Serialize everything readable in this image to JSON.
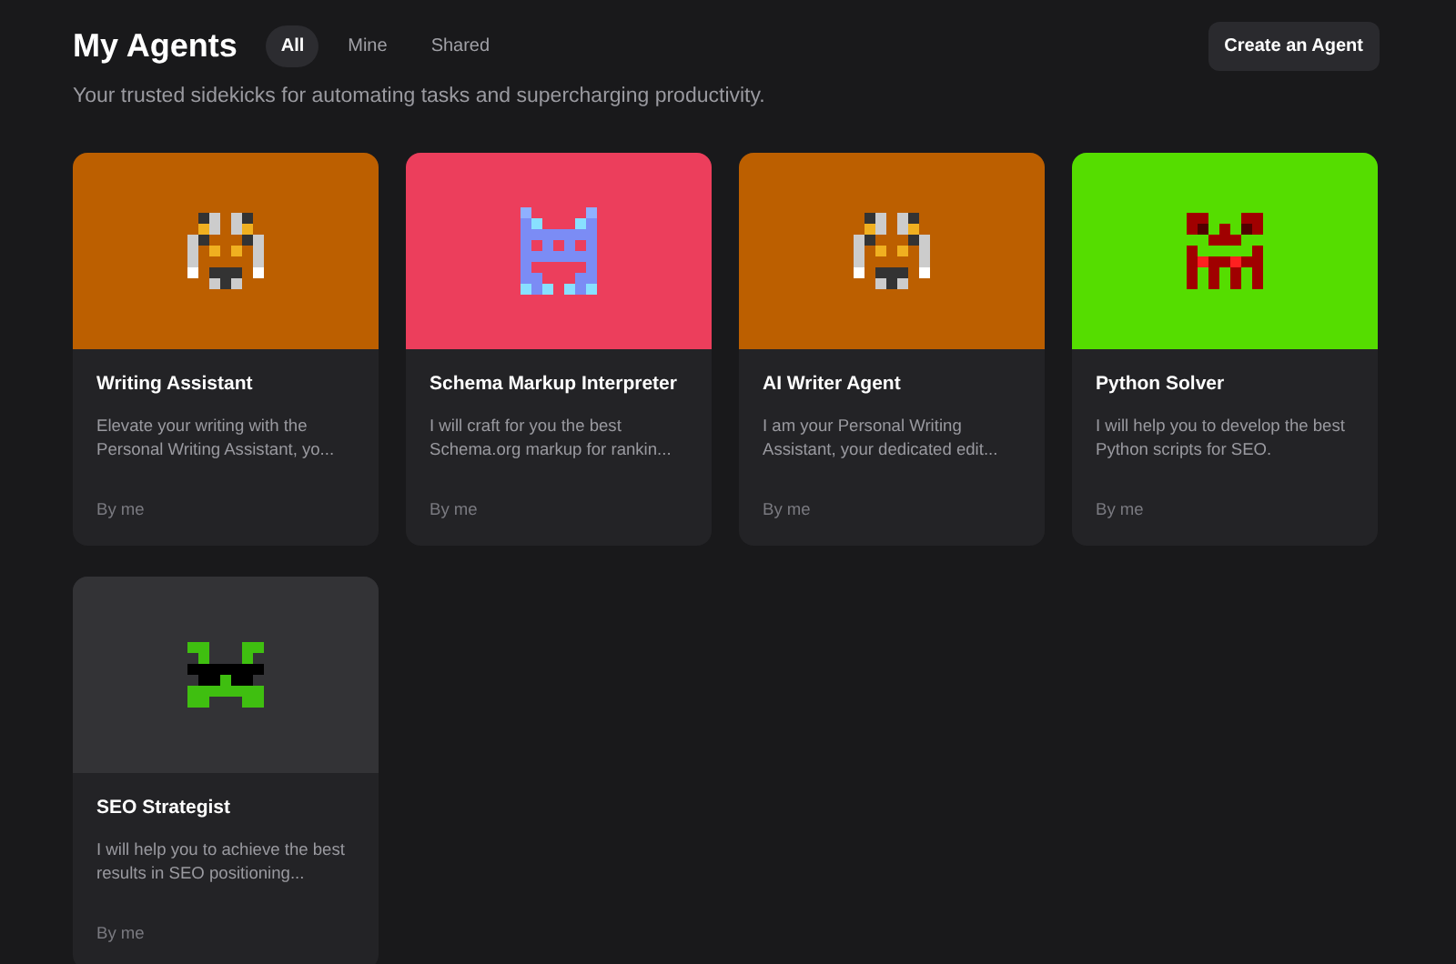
{
  "header": {
    "title": "My Agents",
    "subtitle": "Your trusted sidekicks for automating tasks and supercharging productivity.",
    "create_button": "Create an Agent"
  },
  "tabs": [
    {
      "label": "All",
      "selected": true
    },
    {
      "label": "Mine",
      "selected": false
    },
    {
      "label": "Shared",
      "selected": false
    }
  ],
  "agents": [
    {
      "name": "Writing Assistant",
      "description": "Elevate your writing with the Personal Writing Assistant, yo...",
      "author": "By me",
      "color": "#bc5f00",
      "kind": "fox"
    },
    {
      "name": "Schema Markup Interpreter",
      "description": "I will craft for you the best Schema.org markup for rankin...",
      "author": "By me",
      "color": "#ec3e5c",
      "kind": "robot"
    },
    {
      "name": "AI Writer Agent",
      "description": "I am your Personal Writing Assistant, your dedicated edit...",
      "author": "By me",
      "color": "#bc5f00",
      "kind": "fox"
    },
    {
      "name": "Python Solver",
      "description": "I will help you to develop the best Python scripts for SEO.",
      "author": "By me",
      "color": "#55dd00",
      "kind": "invader"
    },
    {
      "name": "SEO Strategist",
      "description": "I will help you to achieve the best results in SEO positioning...",
      "author": "By me",
      "color": "#333336",
      "kind": "shades"
    }
  ]
}
